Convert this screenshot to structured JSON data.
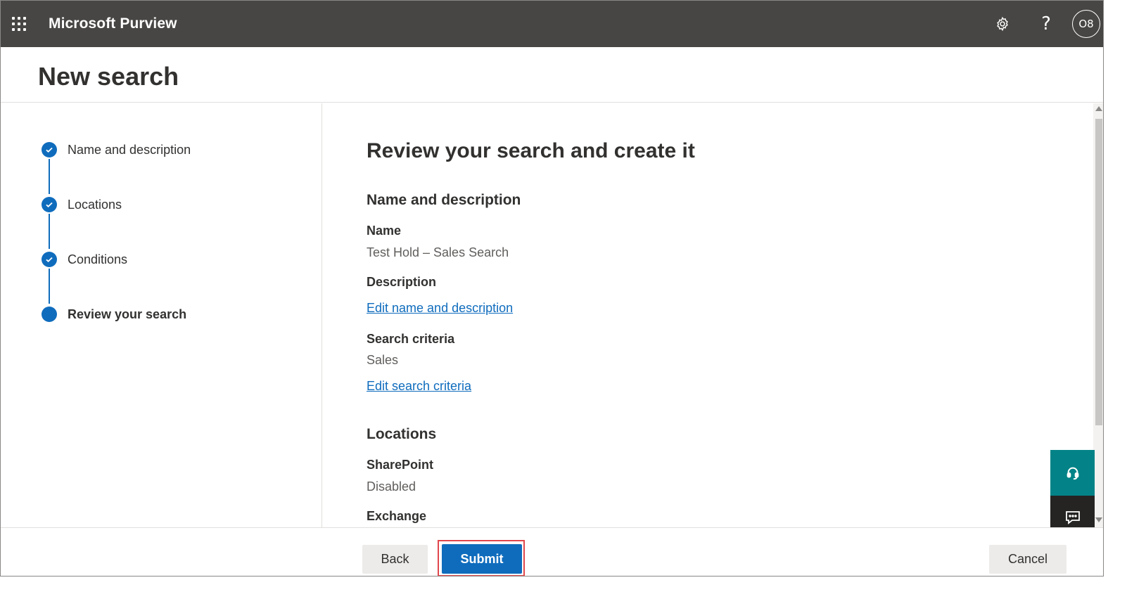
{
  "app": {
    "name": "Microsoft Purview",
    "avatar_initials": "O8",
    "help_glyph": "?",
    "icons": [
      "app-launcher-icon",
      "settings-icon",
      "help-icon",
      "support-headset-icon",
      "feedback-icon",
      "check-icon"
    ]
  },
  "page": {
    "title": "New search"
  },
  "steps": [
    {
      "label": "Name and description",
      "status": "completed"
    },
    {
      "label": "Locations",
      "status": "completed"
    },
    {
      "label": "Conditions",
      "status": "completed"
    },
    {
      "label": "Review your search",
      "status": "current"
    }
  ],
  "review": {
    "heading": "Review your search and create it",
    "name_section": {
      "title": "Name and description",
      "name_label": "Name",
      "name_value": "Test Hold – Sales Search",
      "description_label": "Description",
      "edit_link": "Edit name and description",
      "criteria_label": "Search criteria",
      "criteria_value": "Sales",
      "edit_criteria_link": "Edit search criteria"
    },
    "locations_section": {
      "title": "Locations",
      "sharepoint_label": "SharePoint",
      "sharepoint_value": "Disabled",
      "exchange_label": "Exchange"
    }
  },
  "footer": {
    "back_label": "Back",
    "submit_label": "Submit",
    "cancel_label": "Cancel"
  },
  "colors": {
    "topbar": "#484644",
    "accent": "#0f6cbd",
    "highlight": "#e0474c",
    "support": "#038387"
  }
}
